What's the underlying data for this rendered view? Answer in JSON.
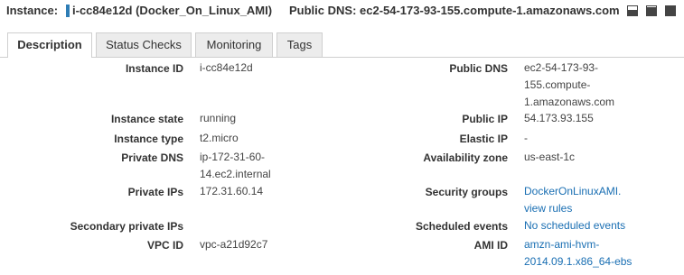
{
  "header": {
    "instance_label": "Instance:",
    "instance_name": "i-cc84e12d (Docker_On_Linux_AMI)",
    "dns_label": "Public DNS:",
    "dns_value": "ec2-54-173-93-155.compute-1.amazonaws.com"
  },
  "tabs": [
    {
      "label": "Description",
      "active": true
    },
    {
      "label": "Status Checks",
      "active": false
    },
    {
      "label": "Monitoring",
      "active": false
    },
    {
      "label": "Tags",
      "active": false
    }
  ],
  "details_left": [
    {
      "label": "Instance ID",
      "value": "i-cc84e12d"
    },
    {
      "label": "Instance state",
      "value": "running"
    },
    {
      "label": "Instance type",
      "value": "t2.micro"
    },
    {
      "label": "Private DNS",
      "value": "ip-172-31-60-14.ec2.internal"
    },
    {
      "label": "Private IPs",
      "value": "172.31.60.14"
    },
    {
      "label": "Secondary private IPs",
      "value": ""
    },
    {
      "label": "VPC ID",
      "value": "vpc-a21d92c7"
    }
  ],
  "details_right": [
    {
      "label": "Public DNS",
      "value": "ec2-54-173-93-155.compute-1.amazonaws.com"
    },
    {
      "label": "Public IP",
      "value": "54.173.93.155"
    },
    {
      "label": "Elastic IP",
      "value": "-"
    },
    {
      "label": "Availability zone",
      "value": "us-east-1c"
    },
    {
      "label": "Security groups",
      "value": "DockerOnLinuxAMI.",
      "link2": "view rules"
    },
    {
      "label": "Scheduled events",
      "value": "No scheduled events"
    },
    {
      "label": "AMI ID",
      "value": "amzn-ami-hvm-2014.09.1.x86_64-ebs"
    }
  ],
  "colors": {
    "link": "#1a6fb3",
    "instance_marker": "#2e7db5"
  }
}
